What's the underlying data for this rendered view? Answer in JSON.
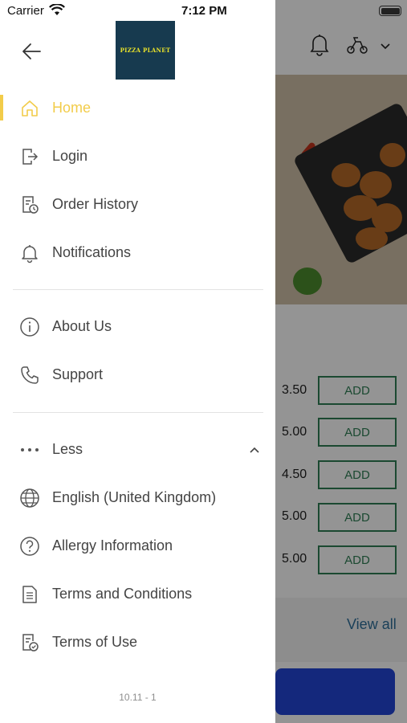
{
  "status_bar": {
    "carrier": "Carrier",
    "time": "7:12 PM"
  },
  "drawer": {
    "logo_text": "PIZZA PLANET",
    "menu_items": [
      {
        "label": "Home",
        "icon": "home-icon",
        "active": true
      },
      {
        "label": "Login",
        "icon": "login-icon"
      },
      {
        "label": "Order History",
        "icon": "order-history-icon"
      },
      {
        "label": "Notifications",
        "icon": "bell-icon"
      }
    ],
    "info_items": [
      {
        "label": "About Us",
        "icon": "info-icon"
      },
      {
        "label": "Support",
        "icon": "phone-icon"
      }
    ],
    "less_label": "Less",
    "more_items": [
      {
        "label": "English (United Kingdom)",
        "icon": "globe-icon"
      },
      {
        "label": "Allergy Information",
        "icon": "question-icon"
      },
      {
        "label": "Terms and Conditions",
        "icon": "document-icon"
      },
      {
        "label": "Terms of Use",
        "icon": "document-check-icon"
      }
    ],
    "version": "10.11 - 1",
    "accent_color": "#f2cc4a"
  },
  "background": {
    "prices": [
      "3.50",
      "5.00",
      "4.50",
      "5.00",
      "5.00"
    ],
    "add_label": "ADD",
    "view_all": "View all",
    "add_color": "#2f7f55",
    "cta_color": "#2346d6"
  }
}
